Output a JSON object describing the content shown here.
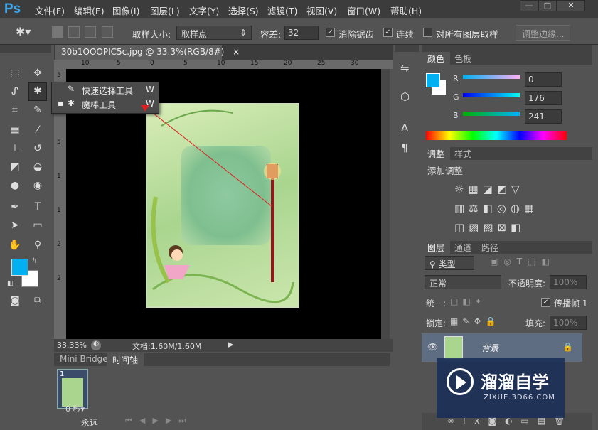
{
  "app": {
    "logo": "Ps"
  },
  "menu": [
    "文件(F)",
    "编辑(E)",
    "图像(I)",
    "图层(L)",
    "文字(Y)",
    "选择(S)",
    "滤镜(T)",
    "视图(V)",
    "窗口(W)",
    "帮助(H)"
  ],
  "window_controls": {
    "minimize": "—",
    "maximize": "□",
    "close": "✕"
  },
  "options": {
    "sample_size_label": "取样大小:",
    "sample_size_value": "取样点",
    "tolerance_label": "容差:",
    "tolerance_value": "32",
    "antialias_label": "消除锯齿",
    "contiguous_label": "连续",
    "sample_all_label": "对所有图层取样",
    "refine_edge_label": "调整边缘..."
  },
  "document": {
    "tab_title": "30b1OOOPIC5c.jpg @ 33.3%(RGB/8#)",
    "tab_close": "×",
    "zoom": "33.33%",
    "doc_info": "文档:1.60M/1.60M"
  },
  "ruler": {
    "h": [
      "10",
      "5",
      "0",
      "5",
      "10",
      "15",
      "20",
      "25",
      "30"
    ],
    "v": [
      "5",
      "0",
      "5",
      "1",
      "1",
      "2",
      "2"
    ]
  },
  "flyout": {
    "items": [
      {
        "label": "快速选择工具",
        "shortcut": "W"
      },
      {
        "label": "魔棒工具",
        "shortcut": "W"
      }
    ]
  },
  "timeline": {
    "tabs": [
      "Mini Bridge",
      "时间轴"
    ],
    "frame_number": "1",
    "frame_delay": "0 秒▾",
    "loop": "永远"
  },
  "color_panel": {
    "tabs": [
      "颜色",
      "色板"
    ],
    "r_label": "R",
    "g_label": "G",
    "b_label": "B",
    "r": "0",
    "g": "176",
    "b": "241",
    "fg": "#00b0f1"
  },
  "adjust_panel": {
    "tabs": [
      "调整",
      "样式"
    ],
    "title": "添加调整"
  },
  "layers_panel": {
    "tabs": [
      "图层",
      "通道",
      "路径"
    ],
    "filter_label": "♀ 类型",
    "blend_mode": "正常",
    "opacity_label": "不透明度:",
    "opacity_value": "100%",
    "unify_label": "统一:",
    "propagate_label": "传播帧 1",
    "lock_label": "锁定:",
    "fill_label": "填充:",
    "fill_value": "100%",
    "layer_name": "背景"
  },
  "watermark": {
    "title": "溜溜自学",
    "url": "ZIXUE.3D66.COM"
  }
}
